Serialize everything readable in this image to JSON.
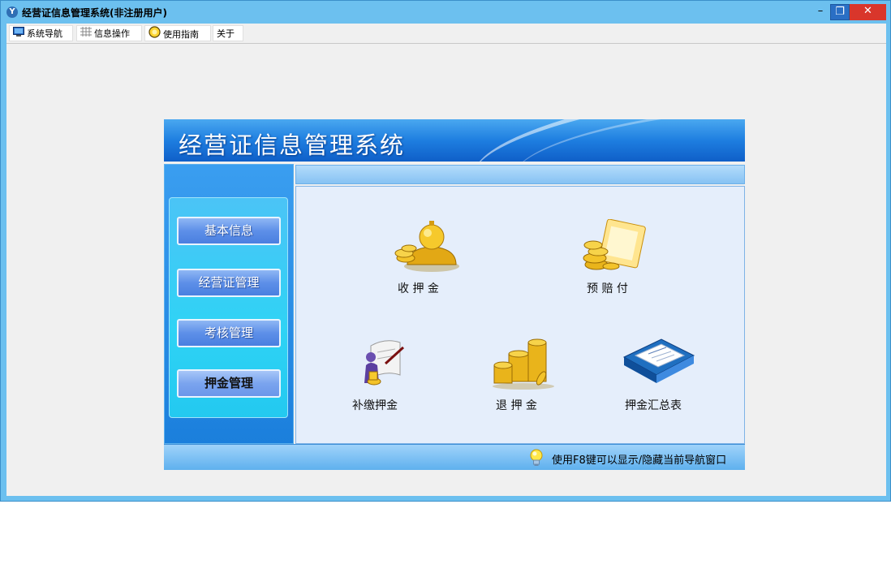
{
  "window": {
    "title": "经营证信息管理系统(非注册用户)",
    "controls": {
      "minimize": "–",
      "restore": "❐",
      "close": "✕"
    }
  },
  "menu": {
    "items": [
      {
        "label": "系统导航",
        "icon": "monitor-icon"
      },
      {
        "label": "信息操作",
        "icon": "grid-icon"
      },
      {
        "label": "使用指南",
        "icon": "guide-icon"
      },
      {
        "label": "关于",
        "icon": ""
      }
    ]
  },
  "banner": {
    "title": "经营证信息管理系统"
  },
  "sidebar": {
    "items": [
      {
        "label": "基本信息",
        "active": false
      },
      {
        "label": "经营证管理",
        "active": false
      },
      {
        "label": "考核管理",
        "active": false
      },
      {
        "label": "押金管理",
        "active": true
      }
    ]
  },
  "content": {
    "tiles": [
      {
        "label": "收 押 金",
        "icon": "coin-bag-icon"
      },
      {
        "label": "预 赔 付",
        "icon": "coin-document-icon"
      },
      {
        "label": "补缴押金",
        "icon": "person-scroll-icon"
      },
      {
        "label": "退 押 金",
        "icon": "coin-stack-icon"
      },
      {
        "label": "押金汇总表",
        "icon": "report-book-icon"
      }
    ]
  },
  "status": {
    "text": "使用F8键可以显示/隐藏当前导航窗口",
    "icon": "lightbulb-icon"
  },
  "colors": {
    "accent": "#1e7ee0",
    "window_frame": "#6cc0ef",
    "close": "#d9362b"
  }
}
